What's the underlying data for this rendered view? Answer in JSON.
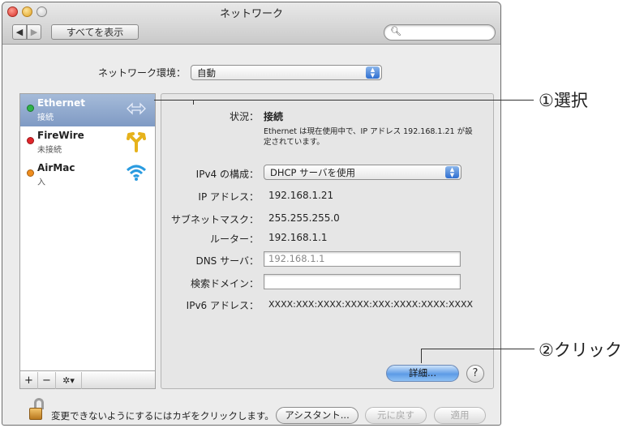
{
  "window": {
    "title": "ネットワーク"
  },
  "toolbar": {
    "back_icon": "◀",
    "forward_icon": "▶",
    "show_all": "すべてを表示",
    "search_placeholder": ""
  },
  "location": {
    "label": "ネットワーク環境：",
    "value": "自動"
  },
  "services": [
    {
      "name": "Ethernet",
      "status": "接続",
      "status_color": "#2fb34a",
      "icon": "ethernet-icon",
      "selected": true
    },
    {
      "name": "FireWire",
      "status": "未接続",
      "status_color": "#e0262b",
      "icon": "firewire-icon",
      "selected": false
    },
    {
      "name": "AirMac",
      "status": "入",
      "status_color": "#ef8d1e",
      "icon": "wifi-icon",
      "selected": false
    }
  ],
  "sidebar_tools": {
    "add": "+",
    "remove": "−",
    "action": "✲▾"
  },
  "detail": {
    "status_label": "状況：",
    "status_value": "接続",
    "status_desc_line1": "Ethernet は現在使用中で、IP アドレス 192.168.1.21 が設",
    "status_desc_line2": "定されています。",
    "ipv4_label": "IPv4 の構成：",
    "ipv4_value": "DHCP サーバを使用",
    "ip_label": "IP アドレス：",
    "ip_value": "192.168.1.21",
    "subnet_label": "サブネットマスク：",
    "subnet_value": "255.255.255.0",
    "router_label": "ルーター：",
    "router_value": "192.168.1.1",
    "dns_label": "DNS サーバ：",
    "dns_value": "192.168.1.1",
    "search_domain_label": "検索ドメイン：",
    "search_domain_value": "",
    "ipv6_label": "IPv6 アドレス：",
    "ipv6_value": "XXXX:XXX:XXXX:XXXX:XXX:XXXX:XXXX:XXXX",
    "advanced_button": "詳細...",
    "help_button": "?"
  },
  "footer": {
    "lock_text": "変更できないようにするにはカギをクリックします。",
    "assistant_button": "アシスタント...",
    "revert_button": "元に戻す",
    "apply_button": "適用"
  },
  "annotations": {
    "select": "①選択",
    "click": "②クリック"
  }
}
